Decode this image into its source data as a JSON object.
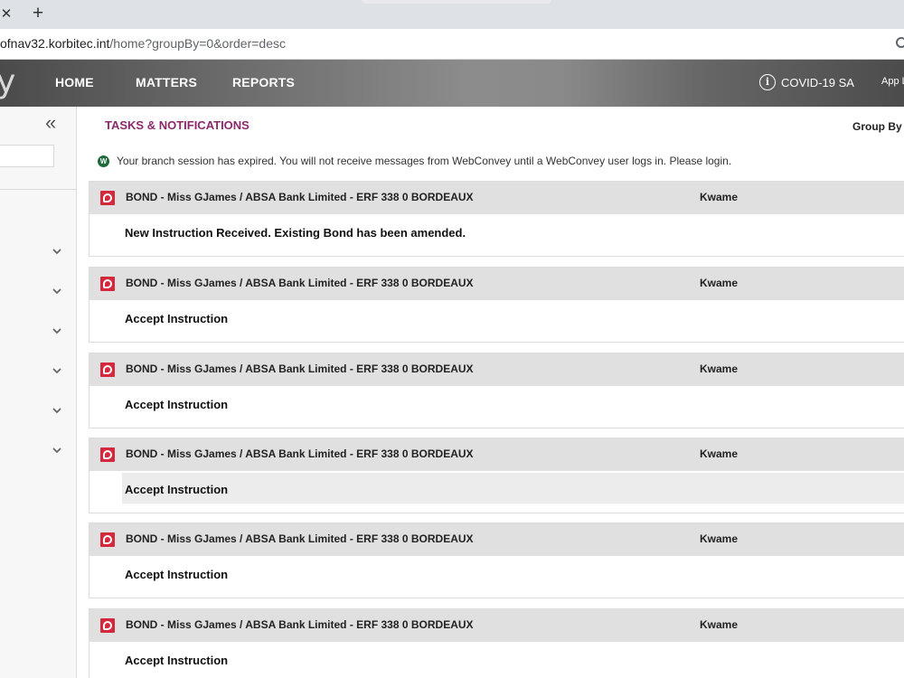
{
  "browser": {
    "url_prefix": "ofnav32.korbitec.int",
    "url_path": "/home?groupBy=0&order=desc"
  },
  "header": {
    "logo_fragment": "y",
    "nav": [
      "HOME",
      "MATTERS",
      "REPORTS"
    ],
    "covid_label": "COVID-19 SA",
    "app_link": "App L"
  },
  "main": {
    "title": "TASKS & NOTIFICATIONS",
    "group_by_label": "Group By",
    "session_message": "Your branch session has expired. You will not receive messages from WebConvey until a WebConvey user logs in. Please login."
  },
  "tasks": [
    {
      "title": "BOND - Miss GJames / ABSA Bank Limited - ERF 338 0 BORDEAUX",
      "user": "Kwame",
      "detail": "New Instruction Received. Existing Bond has been amended."
    },
    {
      "title": "BOND - Miss GJames / ABSA Bank Limited - ERF 338 0 BORDEAUX",
      "user": "Kwame",
      "detail": "Accept Instruction"
    },
    {
      "title": "BOND - Miss GJames / ABSA Bank Limited - ERF 338 0 BORDEAUX",
      "user": "Kwame",
      "detail": "Accept Instruction"
    },
    {
      "title": "BOND - Miss GJames / ABSA Bank Limited - ERF 338 0 BORDEAUX",
      "user": "Kwame",
      "detail": "Accept Instruction"
    },
    {
      "title": "BOND - Miss GJames / ABSA Bank Limited - ERF 338 0 BORDEAUX",
      "user": "Kwame",
      "detail": "Accept Instruction"
    },
    {
      "title": "BOND - Miss GJames / ABSA Bank Limited - ERF 338 0 BORDEAUX",
      "user": "Kwame",
      "detail": "Accept Instruction"
    }
  ],
  "colors": {
    "title_accent": "#8b2a6b",
    "badge_red": "#d4283c",
    "webconvey_green": "#1e6b3a"
  },
  "icons": [
    "close-icon",
    "plus-icon",
    "key-icon",
    "info-icon",
    "double-chevron-left-icon",
    "chevron-down-icon",
    "webconvey-icon",
    "absa-icon"
  ]
}
